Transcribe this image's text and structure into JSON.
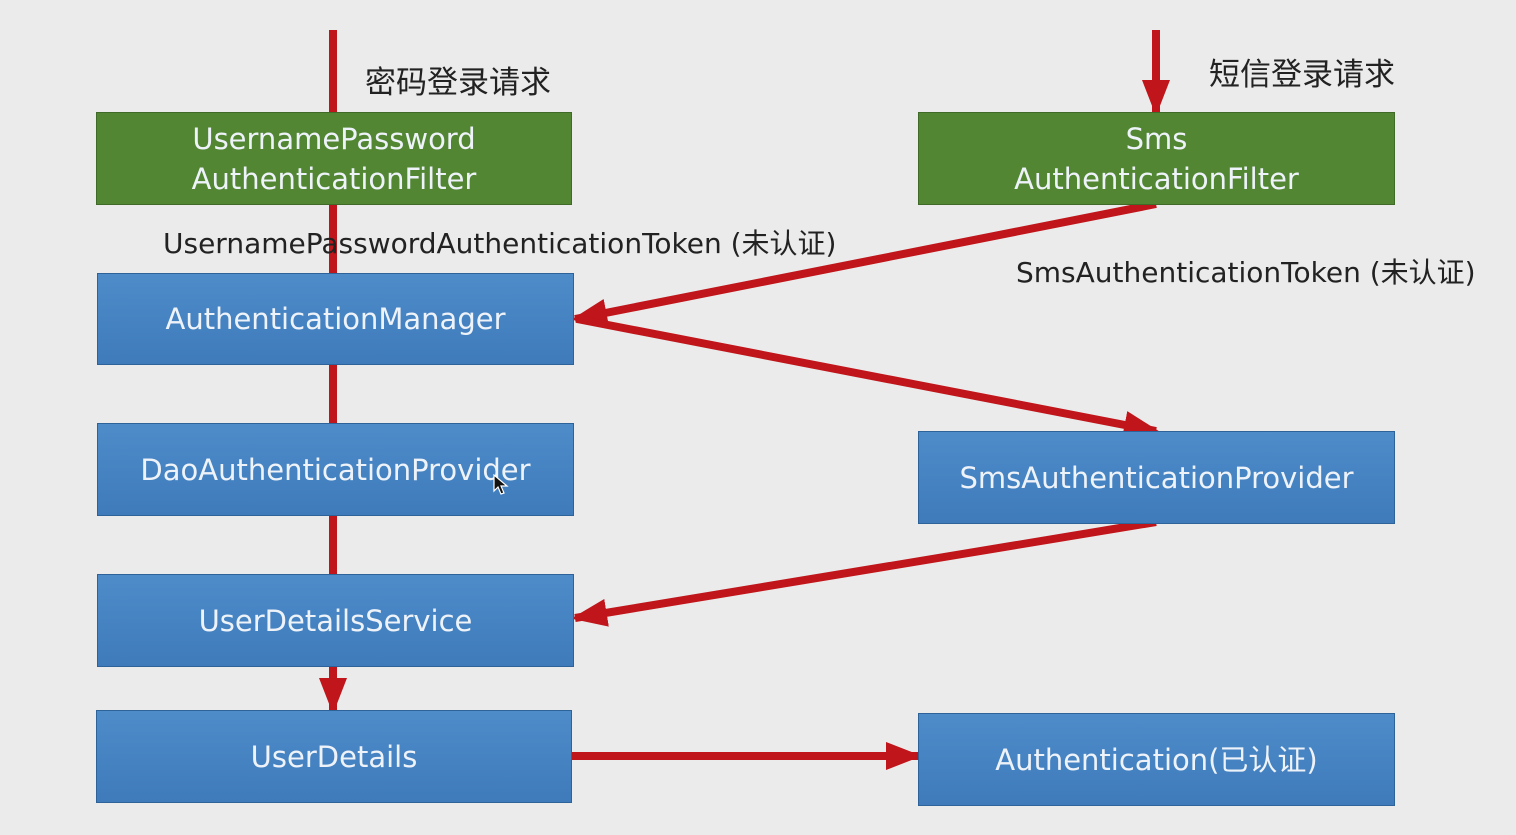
{
  "requests": {
    "password_request": "密码登录请求",
    "sms_request": "短信登录请求"
  },
  "tokens": {
    "password_token": "UsernamePasswordAuthenticationToken (未认证)",
    "sms_token": "SmsAuthenticationToken (未认证)"
  },
  "nodes": {
    "username_password_filter": {
      "line1": "UsernamePassword",
      "line2": "AuthenticationFilter"
    },
    "sms_filter": {
      "line1": "Sms",
      "line2": "AuthenticationFilter"
    },
    "authentication_manager": "AuthenticationManager",
    "dao_provider": "DaoAuthenticationProvider",
    "sms_provider": "SmsAuthenticationProvider",
    "user_details_service": "UserDetailsService",
    "user_details": "UserDetails",
    "authentication": "Authentication(已认证)"
  },
  "colors": {
    "filter_green": "#528633",
    "component_blue": "#4684c3",
    "arrow_red": "#c0151a",
    "background": "#ebebeb"
  }
}
